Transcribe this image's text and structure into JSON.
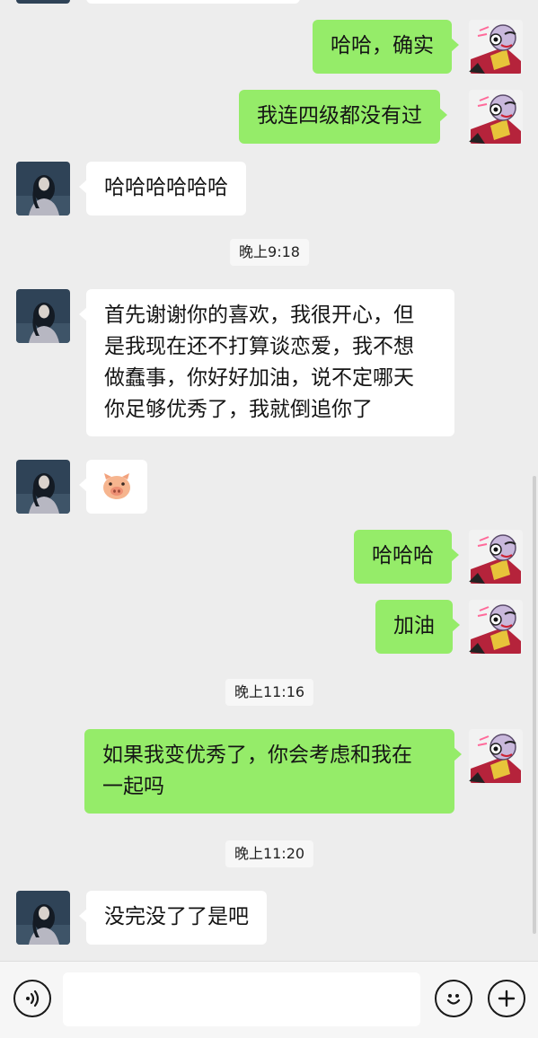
{
  "messages": {
    "m1": "哈哈，确实",
    "m2": "我连四级都没有过",
    "m3": "哈哈哈哈哈哈",
    "m4_lines": [
      "首先谢谢你的喜欢，我很开心，但",
      "是我现在还不打算谈恋爱，我不想",
      "做蠢事，你好好加油，说不定哪天",
      "你足够优秀了，我就倒追你了"
    ],
    "m5_sticker": "pig-face",
    "m6": "哈哈哈",
    "m7": "加油",
    "m8_lines": [
      "如果我变优秀了，你会考虑和我在",
      "一起吗"
    ],
    "m9": "没完没了了是吧"
  },
  "timestamps": {
    "t1": "晚上9:18",
    "t2": "晚上11:16",
    "t3": "晚上11:20"
  },
  "input": {
    "voice_icon": "voice-icon",
    "emoji_icon": "emoji-icon",
    "plus_icon": "plus-icon",
    "placeholder": ""
  },
  "colors": {
    "background": "#ededed",
    "outgoing_bubble": "#95ec69",
    "incoming_bubble": "#ffffff"
  }
}
